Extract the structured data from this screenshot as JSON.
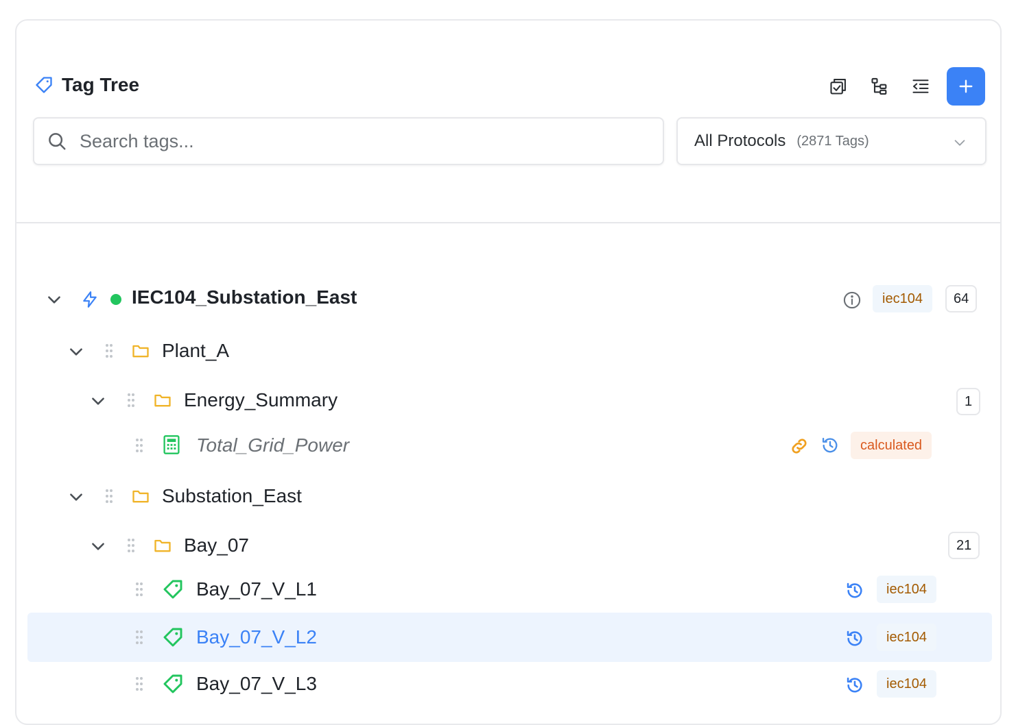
{
  "header": {
    "title": "Tag Tree",
    "toolbar": {
      "check_icon": "multi-select-icon",
      "tree_icon": "tree-structure-icon",
      "collapse_icon": "outdent-icon",
      "add_label": "+"
    },
    "search": {
      "placeholder": "Search tags..."
    },
    "protocol_select": {
      "value": "All Protocols",
      "count": "(2871 Tags)"
    }
  },
  "tree": {
    "root": {
      "name": "IEC104_Substation_East",
      "protocol": "iec104",
      "count": "64",
      "status_color": "#22c55e"
    },
    "plant_a": {
      "name": "Plant_A"
    },
    "energy_summary": {
      "name": "Energy_Summary",
      "count": "1"
    },
    "total_grid_power": {
      "name": "Total_Grid_Power",
      "type": "calculated"
    },
    "substation_east": {
      "name": "Substation_East"
    },
    "bay_07": {
      "name": "Bay_07",
      "count": "21"
    },
    "tags": [
      {
        "name": "Bay_07_V_L1",
        "protocol": "iec104"
      },
      {
        "name": "Bay_07_V_L2",
        "protocol": "iec104"
      },
      {
        "name": "Bay_07_V_L3",
        "protocol": "iec104"
      }
    ]
  },
  "colors": {
    "accent": "#3b82f6",
    "folder": "#f0b429",
    "tag": "#22c55e",
    "selected_bg": "#edf4fe"
  }
}
